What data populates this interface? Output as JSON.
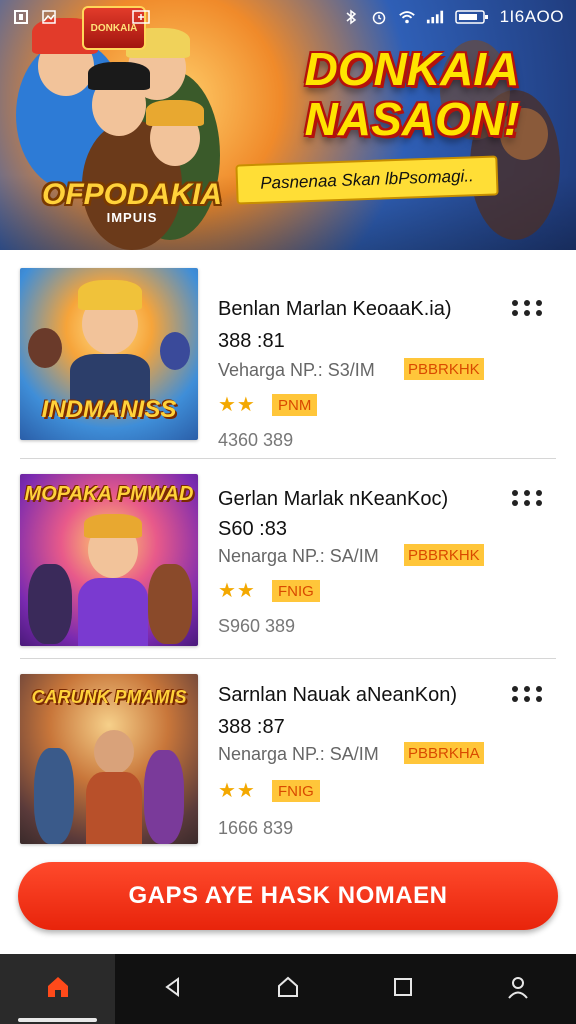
{
  "status_bar": {
    "time": "1I6AOO",
    "icons": [
      "square-icon",
      "image-icon",
      "plus-box-icon",
      "bluetooth-icon",
      "alarm-icon",
      "wifi-icon",
      "signal-icon",
      "battery-icon"
    ]
  },
  "banner": {
    "badge": "DONKAIA",
    "title_line1": "DONKAIA",
    "title_line2": "NASAON!",
    "subtitle": "Pasnenaa Skan lbPsomagi..",
    "logo_main": "OFPODAKIA",
    "logo_sub": "IMPUIS"
  },
  "items": [
    {
      "thumb_title": "INDMANISS",
      "title": "Benlan Marlan KeoaaK.ia)",
      "price": "388 :81",
      "meta": "Veharga  NP.: S3/IM",
      "tag": "PBBRKHK",
      "stars": "★★",
      "stars_tag": "PNM",
      "count": "4360 389"
    },
    {
      "thumb_title": "MOPAKA PMWAD",
      "title": "Gerlan Marlak nKeanKoc)",
      "price": "S60 :83",
      "meta": "Nenarga  NP.: SA/IM",
      "tag": "PBBRKHK",
      "stars": "★★",
      "stars_tag": "FNIG",
      "count": "S960 389"
    },
    {
      "thumb_title": "CARUNK PMAMIS",
      "title": "Sarnlan Nauak aNeanKon)",
      "price": "388 :87",
      "meta": "Nenarga  NP.: SA/IM",
      "tag": "PBBRKHA",
      "stars": "★★",
      "stars_tag": "FNIG",
      "count": "1666 839"
    }
  ],
  "cta": {
    "label": "GAPS AYE HASK NOMAEN"
  },
  "nav": {
    "items": [
      "home-icon",
      "back-icon",
      "home-circle-icon",
      "recents-icon",
      "profile-icon"
    ],
    "active": "home-icon"
  },
  "colors": {
    "accent": "#f0300f",
    "tag_bg": "#ffc63a",
    "tag_text": "#d94a00",
    "star": "#f3a800",
    "nav_bg": "#111111",
    "nav_active_icon": "#ff4a1a"
  }
}
